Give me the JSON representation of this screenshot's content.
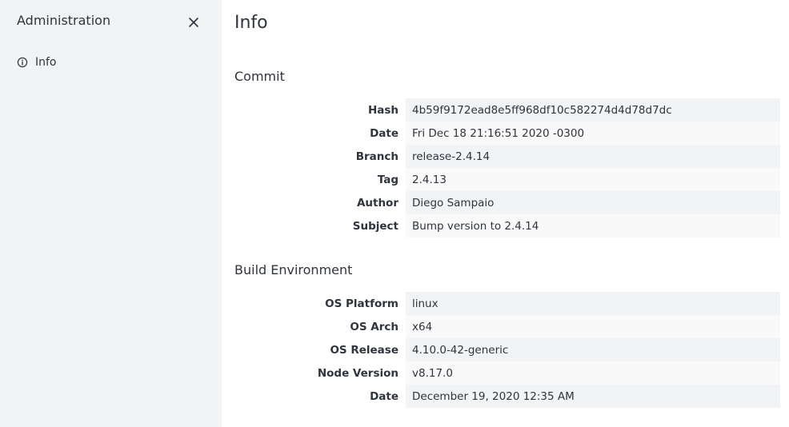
{
  "sidebar": {
    "title": "Administration",
    "close_icon": "close-icon",
    "items": [
      {
        "label": "Info",
        "icon": "info-circle-icon"
      }
    ]
  },
  "main": {
    "title": "Info",
    "commit": {
      "heading": "Commit",
      "rows": [
        {
          "key": "Hash",
          "value": "4b59f9172ead8e5ff968df10c582274d4d78d7dc"
        },
        {
          "key": "Date",
          "value": "Fri Dec 18 21:16:51 2020 -0300"
        },
        {
          "key": "Branch",
          "value": "release-2.4.14"
        },
        {
          "key": "Tag",
          "value": "2.4.13"
        },
        {
          "key": "Author",
          "value": "Diego Sampaio"
        },
        {
          "key": "Subject",
          "value": "Bump version to 2.4.14"
        }
      ]
    },
    "build": {
      "heading": "Build Environment",
      "rows": [
        {
          "key": "OS Platform",
          "value": "linux"
        },
        {
          "key": "OS Arch",
          "value": "x64"
        },
        {
          "key": "OS Release",
          "value": "4.10.0-42-generic"
        },
        {
          "key": "Node Version",
          "value": "v8.17.0"
        },
        {
          "key": "Date",
          "value": "December 19, 2020 12:35 AM"
        }
      ]
    }
  },
  "colors": {
    "sidebar_bg": "#f2f3f5",
    "text": "#2f343d",
    "row_odd": "#f2f3f5",
    "row_even": "#f9f9fa"
  }
}
